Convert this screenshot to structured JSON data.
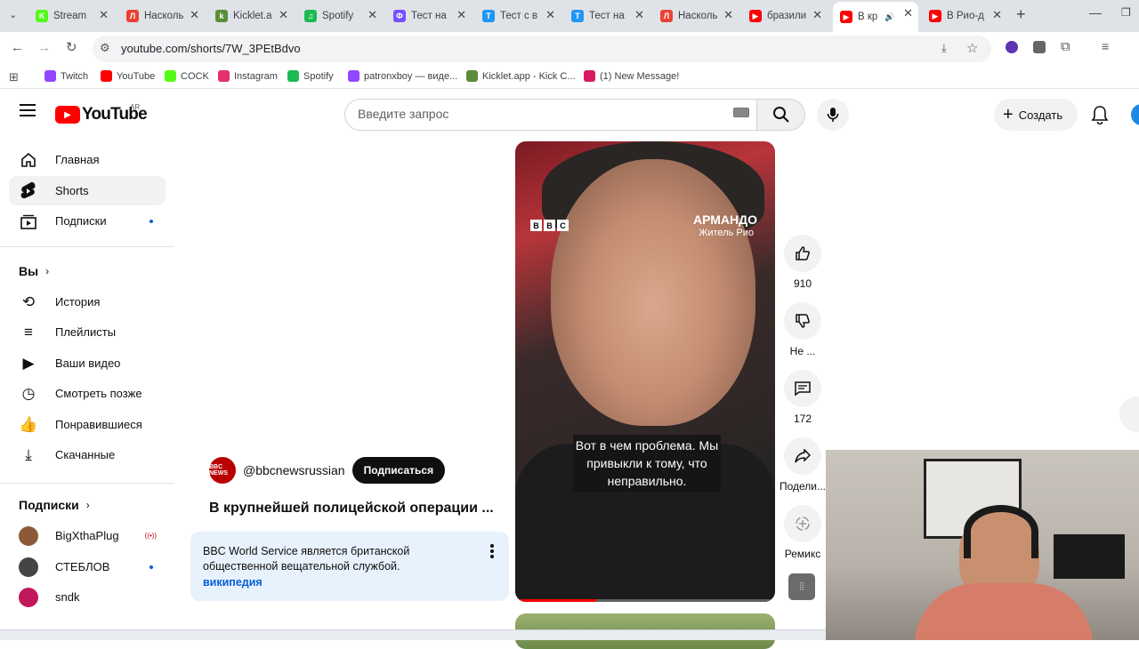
{
  "browser": {
    "tabs": [
      {
        "title": "Stream",
        "color": "#53fc18",
        "letter": "K"
      },
      {
        "title": "Насколь",
        "color": "#e94235",
        "letter": "Л"
      },
      {
        "title": "Kicklet.a",
        "color": "#5b8c3a",
        "letter": "k"
      },
      {
        "title": "Spotify",
        "color": "#1db954",
        "letter": "♫"
      },
      {
        "title": "Тест на",
        "color": "#7c4dff",
        "letter": "Ф"
      },
      {
        "title": "Тест с в",
        "color": "#2196f3",
        "letter": "Т"
      },
      {
        "title": "Тест на",
        "color": "#2196f3",
        "letter": "Т"
      },
      {
        "title": "Насколь",
        "color": "#e94235",
        "letter": "Л"
      },
      {
        "title": "бразили",
        "color": "#ff0000",
        "letter": "▶"
      },
      {
        "title": "В кр",
        "color": "#ff0000",
        "letter": "▶"
      },
      {
        "title": "В Рио-д",
        "color": "#ff0000",
        "letter": "▶"
      }
    ],
    "url": "youtube.com/shorts/7W_3PEtBdvo",
    "bookmarks": [
      {
        "label": "Twitch",
        "color": "#9146ff"
      },
      {
        "label": "YouTube",
        "color": "#ff0000"
      },
      {
        "label": "COCK",
        "color": "#53fc18"
      },
      {
        "label": "Instagram",
        "color": "#e1306c"
      },
      {
        "label": "Spotify",
        "color": "#1db954"
      },
      {
        "label": "patronxboy — виде...",
        "color": "#9146ff"
      },
      {
        "label": "Kicklet.app - Kick C...",
        "color": "#5b8c3a"
      },
      {
        "label": "(1) New Message!",
        "color": "#d81b60"
      }
    ]
  },
  "youtube": {
    "logo": "YouTube",
    "country": "AR",
    "search_placeholder": "Введите запрос",
    "create_label": "Создать"
  },
  "sidebar": {
    "main": [
      {
        "label": "Главная",
        "icon": "home-icon"
      },
      {
        "label": "Shorts",
        "icon": "shorts-icon"
      },
      {
        "label": "Подписки",
        "icon": "subscriptions-icon"
      }
    ],
    "you_heading": "Вы",
    "you": [
      {
        "label": "История",
        "icon": "history-icon"
      },
      {
        "label": "Плейлисты",
        "icon": "playlists-icon"
      },
      {
        "label": "Ваши видео",
        "icon": "your-videos-icon"
      },
      {
        "label": "Смотреть позже",
        "icon": "watch-later-icon"
      },
      {
        "label": "Понравившиеся",
        "icon": "liked-icon"
      },
      {
        "label": "Скачанные",
        "icon": "downloads-icon"
      }
    ],
    "subs_heading": "Подписки",
    "subs": [
      {
        "label": "BigXthaPlug",
        "color": "#8a5a3a"
      },
      {
        "label": "СТЕБЛОВ",
        "color": "#444444"
      },
      {
        "label": "sndk",
        "color": "#c2185b"
      }
    ]
  },
  "short": {
    "bbc_letters": [
      "B",
      "B",
      "C"
    ],
    "person_name": "АРМАНДО",
    "person_role": "Житель Рио",
    "subtitle": "Вот в чем проблема. Мы привыкли к тому, что неправильно.",
    "progress": 0.31,
    "channel_avatar_text": "BBC NEWS",
    "channel": "@bbcnewsrussian",
    "subscribe_label": "Подписаться",
    "title": "В крупнейшей полицейской операции ...",
    "info_text": "BBC World Service является британской общественной вещательной службой.",
    "info_link": "википедия",
    "actions": {
      "like_count": "910",
      "dislike_label": "Не ...",
      "comment_count": "172",
      "share_label": "Подели...",
      "remix_label": "Ремикс"
    }
  }
}
